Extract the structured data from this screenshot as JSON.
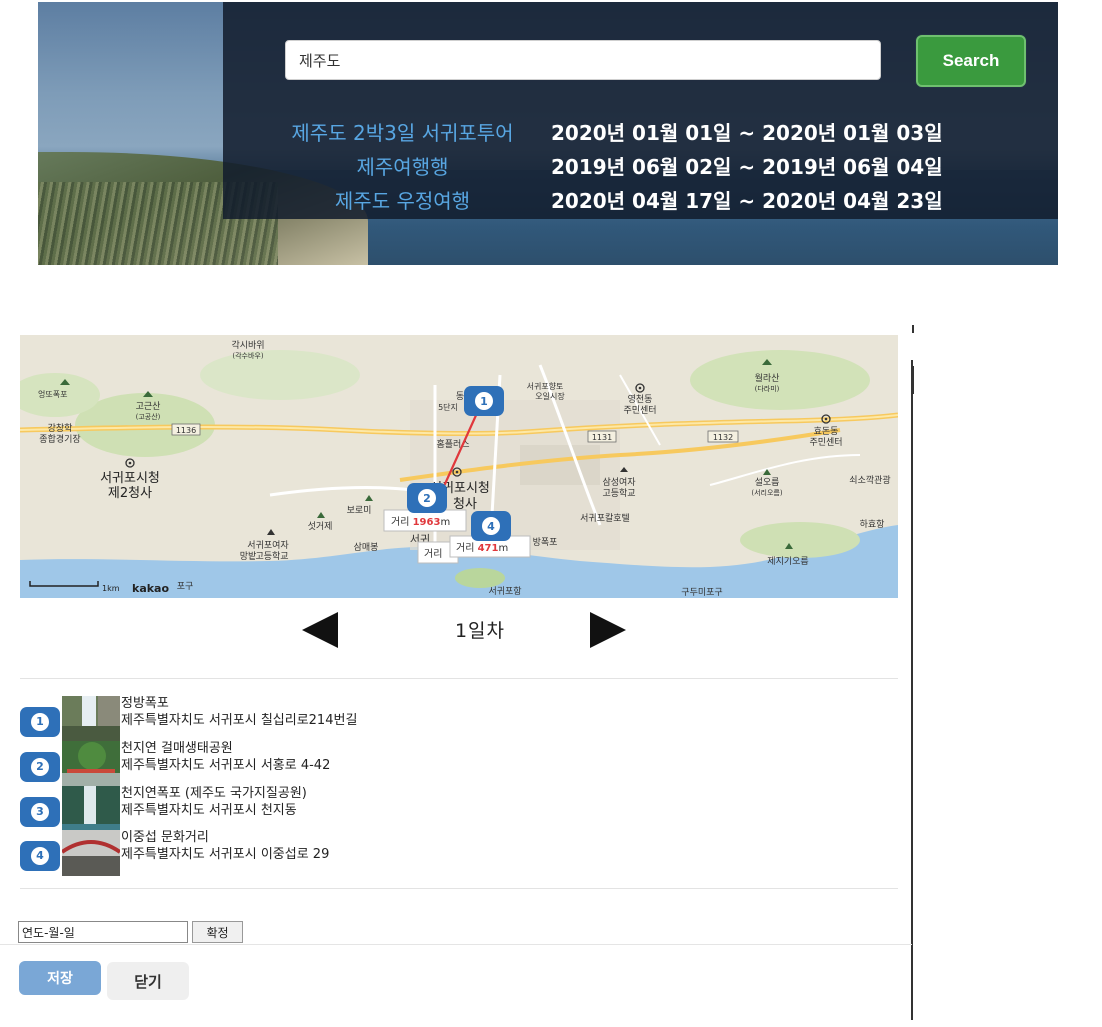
{
  "search": {
    "value": "제주도",
    "button_label": "Search"
  },
  "trips": [
    {
      "name": "제주도 2박3일 서귀포투어",
      "dates": "2020년 01월 01일 ~ 2020년 01월 03일"
    },
    {
      "name": "제주여행행",
      "dates": "2019년 06월 02일 ~ 2019년 06월 04일"
    },
    {
      "name": "제주도 우정여행",
      "dates": "2020년 04월 17일 ~ 2020년 04월 23일"
    }
  ],
  "map": {
    "labels": {
      "gaksi": "각시바위",
      "gaksi_sub": "(각수바우)",
      "yeongtto": "엉또폭포",
      "gogeunsan": "고근산",
      "gogeunsan_sub": "(고공산)",
      "gangchang": "강창학",
      "gangchang2": "종합경기장",
      "city_hall2": "서귀포시청",
      "city_hall2b": "제2청사",
      "dong5": "동",
      "dong5b": "5단지",
      "market": "서귀포향토",
      "market2": "오일시장",
      "yeongcheon": "영천동",
      "yeongcheon2": "주민센터",
      "wollasan": "월라산",
      "wollasan_sub": "(다라미)",
      "hyodon": "효돈동",
      "hyodon2": "주민센터",
      "homeplus": "홈플러스",
      "city_hall": "서귀포시청",
      "city_hall_b": "청사",
      "samseong": "삼성여자",
      "samseong2": "고등학교",
      "seoreum": "설오름",
      "seoreum_sub": "(서리오름)",
      "soesokkak": "쇠소깍관광",
      "boromi": "보로미",
      "setgeoje": "섯거제",
      "hotel": "서귀포칼호텔",
      "hahyo": "하효항",
      "jeongbang_fall": "방폭포",
      "seogwi_girls": "서귀포여자",
      "seogwi_girls2": "고등학교",
      "mangbat": "망밭",
      "sammaebong": "삼매봉",
      "seogwi_short": "서귀",
      "jeji": "제지기오름",
      "seogwi_port": "서귀포항",
      "gudumi": "구두미포구",
      "road1136": "1136",
      "road1131": "1131",
      "road1132": "1132",
      "scale": "1km",
      "logo": "kakao",
      "port_cut": "포구"
    },
    "dist1": {
      "prefix": "거리",
      "value": "1963",
      "unit": "m"
    },
    "dist2": {
      "prefix": "거리",
      "value": "471",
      "unit": "m"
    },
    "dist2_hidden_prefix": "거리",
    "markers": [
      "1",
      "2",
      "4"
    ]
  },
  "day_label": "1일차",
  "places": [
    {
      "num": "1",
      "name": "정방폭포",
      "address": "제주특별자치도 서귀포시 칠십리로214번길"
    },
    {
      "num": "2",
      "name": "천지연 걸매생태공원",
      "address": "제주특별자치도 서귀포시 서홍로 4-42"
    },
    {
      "num": "3",
      "name": "천지연폭포 (제주도 국가지질공원)",
      "address": "제주특별자치도 서귀포시 천지동"
    },
    {
      "num": "4",
      "name": "이중섭 문화거리",
      "address": "제주특별자치도 서귀포시 이중섭로 29"
    }
  ],
  "date_input": {
    "value": "연도-월-일"
  },
  "confirm_label": "확정",
  "save_label": "저장",
  "close_label": "닫기",
  "colors": {
    "accent_blue": "#2e70b8",
    "search_green": "#3a9a3e",
    "trip_name": "#58a6e2",
    "route_red": "#e0383c"
  }
}
